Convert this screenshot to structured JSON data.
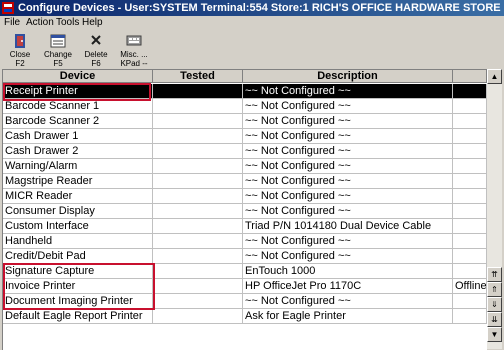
{
  "window": {
    "title": "Configure Devices - User:SYSTEM Terminal:554 Store:1 RICH'S OFFICE HARDWARE STORE"
  },
  "menu": [
    "File",
    "Action",
    "Tools",
    "Help"
  ],
  "toolbar": [
    {
      "label1": "Close",
      "label2": "F2",
      "icon": "close-door-icon"
    },
    {
      "label1": "Change",
      "label2": "F5",
      "icon": "change-icon"
    },
    {
      "label1": "Delete",
      "label2": "F6",
      "icon": "delete-x-icon"
    },
    {
      "label1": "Misc. ...",
      "label2": "KPad --",
      "icon": "misc-keypad-icon"
    }
  ],
  "columns": [
    "Device",
    "Tested",
    "Description"
  ],
  "rows": [
    {
      "device": "Receipt Printer",
      "tested": "",
      "description": "~~ Not Configured ~~",
      "extra": ""
    },
    {
      "device": "Barcode Scanner 1",
      "tested": "",
      "description": "~~ Not Configured ~~",
      "extra": ""
    },
    {
      "device": "Barcode Scanner 2",
      "tested": "",
      "description": "~~ Not Configured ~~",
      "extra": ""
    },
    {
      "device": "Cash Drawer 1",
      "tested": "",
      "description": "~~ Not Configured ~~",
      "extra": ""
    },
    {
      "device": "Cash Drawer 2",
      "tested": "",
      "description": "~~ Not Configured ~~",
      "extra": ""
    },
    {
      "device": "Warning/Alarm",
      "tested": "",
      "description": "~~ Not Configured ~~",
      "extra": ""
    },
    {
      "device": "Magstripe Reader",
      "tested": "",
      "description": "~~ Not Configured ~~",
      "extra": ""
    },
    {
      "device": "MICR Reader",
      "tested": "",
      "description": "~~ Not Configured ~~",
      "extra": ""
    },
    {
      "device": "Consumer Display",
      "tested": "",
      "description": "~~ Not Configured ~~",
      "extra": ""
    },
    {
      "device": "Custom Interface",
      "tested": "",
      "description": "Triad P/N 1014180 Dual Device Cable",
      "extra": ""
    },
    {
      "device": "Handheld",
      "tested": "",
      "description": "~~ Not Configured ~~",
      "extra": ""
    },
    {
      "device": "Credit/Debit Pad",
      "tested": "",
      "description": "~~ Not Configured ~~",
      "extra": ""
    },
    {
      "device": "Signature Capture",
      "tested": "",
      "description": "EnTouch 1000",
      "extra": ""
    },
    {
      "device": "Invoice Printer",
      "tested": "",
      "description": "HP OfficeJet Pro 1170C",
      "extra": "Offline"
    },
    {
      "device": "Document Imaging Printer",
      "tested": "",
      "description": "~~ Not Configured ~~",
      "extra": ""
    },
    {
      "device": "Default Eagle Report Printer",
      "tested": "",
      "description": "Ask for Eagle Printer",
      "extra": ""
    }
  ],
  "selected_row": 0,
  "highlight_color": "#c8102e"
}
